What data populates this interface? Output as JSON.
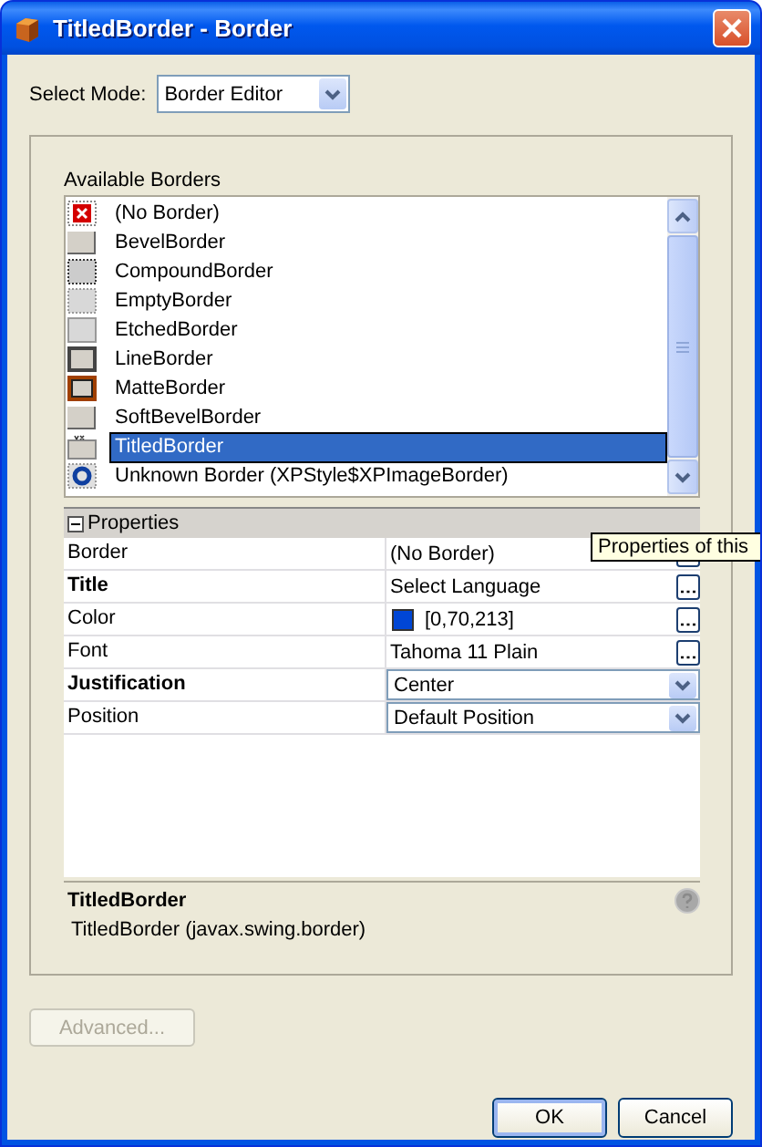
{
  "window": {
    "title": "TitledBorder - Border"
  },
  "mode": {
    "label": "Select Mode:",
    "value": "Border Editor"
  },
  "borders": {
    "label": "Available Borders",
    "items": [
      {
        "label": "(No Border)",
        "kind": "none",
        "selected": false
      },
      {
        "label": "BevelBorder",
        "kind": "bevel",
        "selected": false
      },
      {
        "label": "CompoundBorder",
        "kind": "compound",
        "selected": false
      },
      {
        "label": "EmptyBorder",
        "kind": "empty",
        "selected": false
      },
      {
        "label": "EtchedBorder",
        "kind": "etched",
        "selected": false
      },
      {
        "label": "LineBorder",
        "kind": "line",
        "selected": false
      },
      {
        "label": "MatteBorder",
        "kind": "matte",
        "selected": false
      },
      {
        "label": "SoftBevelBorder",
        "kind": "softbevel",
        "selected": false
      },
      {
        "label": "TitledBorder",
        "kind": "titled",
        "selected": true
      },
      {
        "label": "Unknown Border (XPStyle$XPImageBorder)",
        "kind": "unknown",
        "selected": false
      }
    ]
  },
  "properties": {
    "header": "Properties",
    "expanded": true,
    "rows": [
      {
        "name": "Border",
        "value": "(No Border)",
        "bold": false,
        "kind": "ellipsis"
      },
      {
        "name": "Title",
        "value": "Select Language",
        "bold": true,
        "kind": "ellipsis"
      },
      {
        "name": "Color",
        "value": "[0,70,213]",
        "bold": false,
        "kind": "ellipsis",
        "color": "#0046d5"
      },
      {
        "name": "Font",
        "value": "Tahoma 11 Plain",
        "bold": false,
        "kind": "ellipsis"
      },
      {
        "name": "Justification",
        "value": "Center",
        "bold": true,
        "kind": "combo"
      },
      {
        "name": "Position",
        "value": "Default Position",
        "bold": false,
        "kind": "combo"
      }
    ]
  },
  "tooltip": "Properties of this",
  "description": {
    "title": "TitledBorder",
    "text": "TitledBorder (javax.swing.border)"
  },
  "buttons": [
    {
      "label": "Advanced...",
      "disabled": true
    },
    {
      "label": "OK",
      "disabled": false,
      "default": true
    },
    {
      "label": "Cancel",
      "disabled": false,
      "default": false
    }
  ]
}
